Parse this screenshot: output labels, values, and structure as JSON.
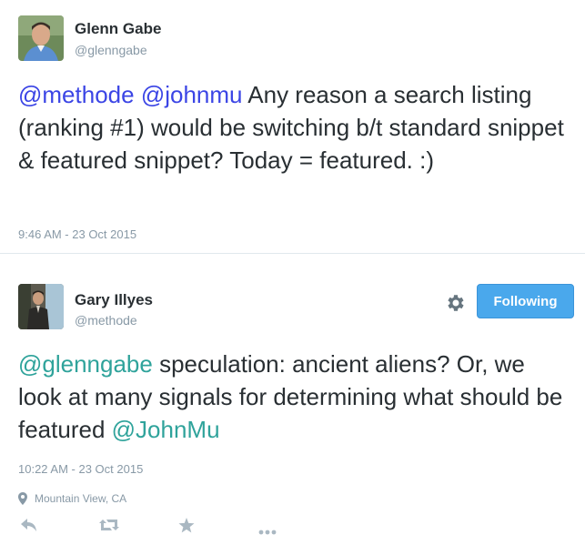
{
  "tweets": [
    {
      "author_name": "Glenn Gabe",
      "author_handle": "@glenngabe",
      "text_parts": [
        {
          "text": "@methode",
          "kind": "mention"
        },
        {
          "text": " ",
          "kind": "text"
        },
        {
          "text": "@johnmu",
          "kind": "mention"
        },
        {
          "text": " Any reason a search listing (ranking #1) would be switching b/t standard snippet & featured snippet? Today = featured. :)",
          "kind": "text"
        }
      ],
      "timestamp": "9:46 AM - 23 Oct 2015"
    },
    {
      "author_name": "Gary Illyes",
      "author_handle": "@methode",
      "follow_button_label": "Following",
      "text_parts": [
        {
          "text": "@glenngabe",
          "kind": "mention"
        },
        {
          "text": " speculation: ancient aliens? Or, we look at many signals for determining what should be featured ",
          "kind": "text"
        },
        {
          "text": "@JohnMu",
          "kind": "mention"
        }
      ],
      "timestamp": "10:22 AM - 23 Oct 2015",
      "location": "Mountain View, CA"
    }
  ],
  "icons": {
    "settings": "gear-icon",
    "location": "map-pin-icon",
    "reply": "reply-icon",
    "retweet": "retweet-icon",
    "favorite": "star-icon",
    "more": "more-icon"
  },
  "colors": {
    "mention_tweet1": "#3b45e5",
    "mention_tweet2": "#2fa39b",
    "button": "#4aa8ec",
    "muted": "#8899a6"
  }
}
